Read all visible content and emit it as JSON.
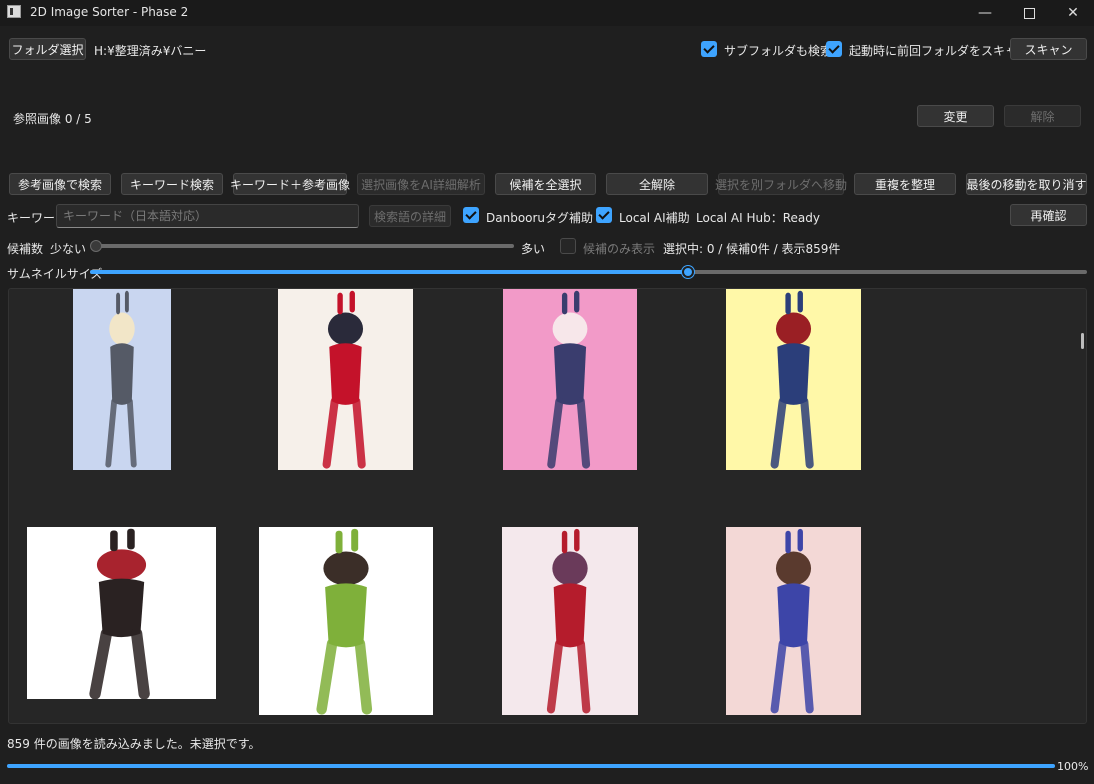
{
  "window": {
    "title": "2D Image Sorter - Phase 2"
  },
  "toolbar": {
    "folder_button": "フォルダ選択",
    "folder_path": "H:¥整理済み¥バニー",
    "subfolder_label": "サブフォルダも検索",
    "scan_on_start_label": "起動時に前回フォルダをスキャン",
    "scan_button": "スキャン"
  },
  "reference": {
    "label": "参照画像  0 / 5",
    "change_button": "変更",
    "clear_button": "解除"
  },
  "actions": [
    "参考画像で検索",
    "キーワード検索",
    "キーワード＋参考画像",
    "選択画像をAI詳細解析",
    "候補を全選択",
    "全解除",
    "選択を別フォルダへ移動",
    "重複を整理",
    "最後の移動を取り消す"
  ],
  "keyword": {
    "label": "キーワード",
    "placeholder": "キーワード（日本語対応）",
    "detail_button": "検索語の詳細",
    "danbooru_label": "Danbooruタグ補助",
    "local_ai_label": "Local AI補助",
    "hub_status": "Local AI Hub：Ready",
    "recheck_button": "再確認"
  },
  "candidates": {
    "label": "候補数",
    "min_label": "少ない",
    "max_label": "多い",
    "level": 0,
    "only_label": "候補のみ表示",
    "status": "選択中: 0 / 候補0件 / 表示859件"
  },
  "thumbnail": {
    "label": "サムネイルサイズ",
    "level": 0.6
  },
  "gallery": {
    "images": [
      {
        "name": "thumbnail-1",
        "palette": [
          "#c9d6f0",
          "#555a66",
          "#f2e6c8"
        ]
      },
      {
        "name": "thumbnail-2",
        "palette": [
          "#f6f0ea",
          "#c4122a",
          "#2a2a3a"
        ]
      },
      {
        "name": "thumbnail-3",
        "palette": [
          "#f29ac8",
          "#3a3d6e",
          "#f7e7ea"
        ]
      },
      {
        "name": "thumbnail-4",
        "palette": [
          "#fff8a8",
          "#2b3e7a",
          "#9a1f24"
        ]
      },
      {
        "name": "thumbnail-5",
        "palette": [
          "#ffffff",
          "#2a2222",
          "#a8232e"
        ]
      },
      {
        "name": "thumbnail-6",
        "palette": [
          "#ffffff",
          "#7fb03a",
          "#3b2e28"
        ]
      },
      {
        "name": "thumbnail-7",
        "palette": [
          "#f4e8ec",
          "#b51c2c",
          "#6a3a5a"
        ]
      },
      {
        "name": "thumbnail-8",
        "palette": [
          "#f3d8d6",
          "#3d45a8",
          "#5a3a2e"
        ]
      }
    ]
  },
  "status": {
    "message": "859 件の画像を読み込みました。未選択です。",
    "progress_label": "100%",
    "progress": 1.0
  },
  "colors": {
    "accent": "#3ea4ff",
    "background": "#1f1f1f"
  }
}
